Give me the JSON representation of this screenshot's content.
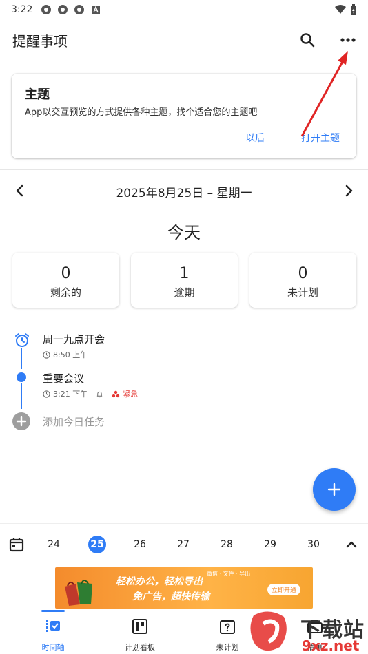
{
  "status_bar": {
    "time": "3:22"
  },
  "app_bar": {
    "title": "提醒事项"
  },
  "theme_card": {
    "title": "主题",
    "description": "App以交互预览的方式提供各种主题，找个适合您的主题吧",
    "later_label": "以后",
    "open_label": "打开主题"
  },
  "date_nav": {
    "date": "2025年8月25日 – 星期一"
  },
  "today_label": "今天",
  "stats": [
    {
      "value": "0",
      "label": "剩余的"
    },
    {
      "value": "1",
      "label": "逾期"
    },
    {
      "value": "0",
      "label": "未计划"
    }
  ],
  "tasks": [
    {
      "title": "周一九点开会",
      "time": "8:50 上午"
    },
    {
      "title": "重要会议",
      "time": "3:21 下午",
      "priority": "紧急"
    }
  ],
  "add_task_placeholder": "添加今日任务",
  "week": {
    "days": [
      "24",
      "25",
      "26",
      "27",
      "28",
      "29",
      "30"
    ],
    "selected": "25"
  },
  "ad": {
    "line1": "轻松办公，轻松导出",
    "line2": "免广告，超快传输",
    "top_tags": "微信 · 文件 · 导出",
    "button": "立即开通"
  },
  "bottom_nav": [
    {
      "label": "时间轴",
      "active": true
    },
    {
      "label": "计划看板",
      "active": false
    },
    {
      "label": "未计划",
      "active": false
    },
    {
      "label": "清单",
      "active": false
    }
  ],
  "watermark": {
    "line1": "下载站",
    "line2": "9xz.net"
  },
  "colors": {
    "accent": "#2f7cf6",
    "urgent": "#e53935",
    "annotation_arrow": "#e02424"
  }
}
